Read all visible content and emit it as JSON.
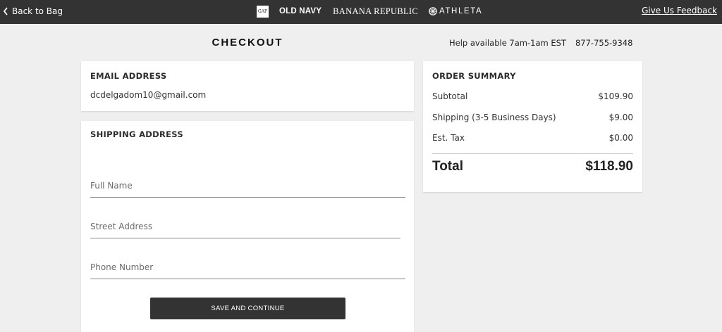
{
  "topbar": {
    "back_label": "Back to Bag",
    "brands": {
      "gap": "GAP",
      "old_navy": "OLD NAVY",
      "banana_republic": "BANANA REPUBLIC",
      "athleta": "ATHLETA"
    },
    "feedback_label": "Give Us Feedback"
  },
  "header": {
    "title": "CHECKOUT",
    "help_text": "Help available 7am-1am EST",
    "phone": "877-755-9348"
  },
  "email": {
    "heading": "EMAIL ADDRESS",
    "value": "dcdelgadom10@gmail.com"
  },
  "shipping": {
    "heading": "SHIPPING ADDRESS",
    "full_name_placeholder": "Full Name",
    "street_placeholder": "Street Address",
    "phone_placeholder": "Phone Number",
    "save_label": "SAVE AND CONTINUE"
  },
  "summary": {
    "heading": "ORDER SUMMARY",
    "rows": [
      {
        "label": "Subtotal",
        "value": "$109.90"
      },
      {
        "label": "Shipping (3-5 Business Days)",
        "value": "$9.00"
      },
      {
        "label": "Est. Tax",
        "value": "$0.00"
      }
    ],
    "total_label": "Total",
    "total_value": "$118.90"
  },
  "colors": {
    "topbar_bg": "#333333",
    "page_bg": "#efefef",
    "button_bg": "#333333"
  },
  "icons": {
    "back": "chevron-left-icon",
    "athleta": "athleta-logo-icon"
  }
}
